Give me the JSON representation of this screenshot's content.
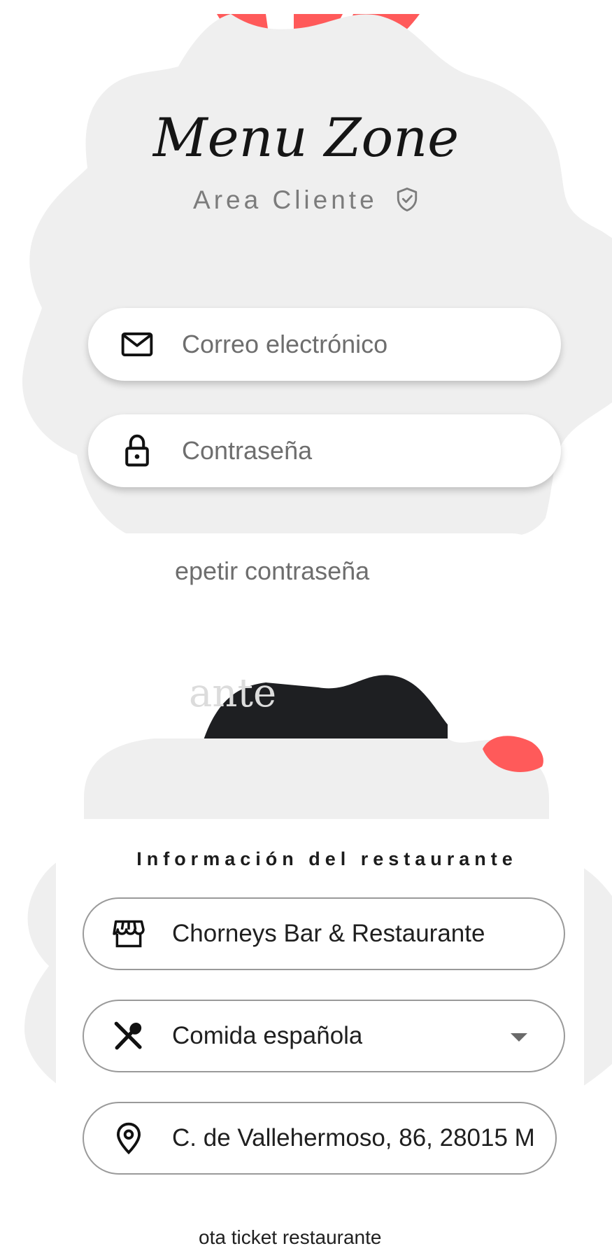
{
  "app": {
    "title": "Menu Zone",
    "subtitle": "Area Cliente"
  },
  "form": {
    "email_placeholder": "Correo electrónico",
    "password_placeholder": "Contraseña",
    "repeat_password_placeholder": "epetir contraseña"
  },
  "restaurant": {
    "partial_heading": "ante",
    "section_title": "Información del restaurante",
    "name": "Chorneys Bar & Restaurante",
    "cuisine": "Comida española",
    "address": "C. de Vallehermoso, 86, 28015 M",
    "bottom_partial": "ota ticket restaurante"
  },
  "colors": {
    "accent": "#ff5a5a",
    "blob": "#efefef",
    "dark": "#1e1f22",
    "text": "#1c1c1c",
    "placeholder": "#6e6e6e"
  },
  "icons": {
    "email": "mail-icon",
    "password": "lock-icon",
    "subtitle_badge": "shield-check-icon",
    "name": "storefront-icon",
    "cuisine": "fork-spoon-icon",
    "address": "location-pin-icon",
    "dropdown": "caret-down-icon"
  }
}
